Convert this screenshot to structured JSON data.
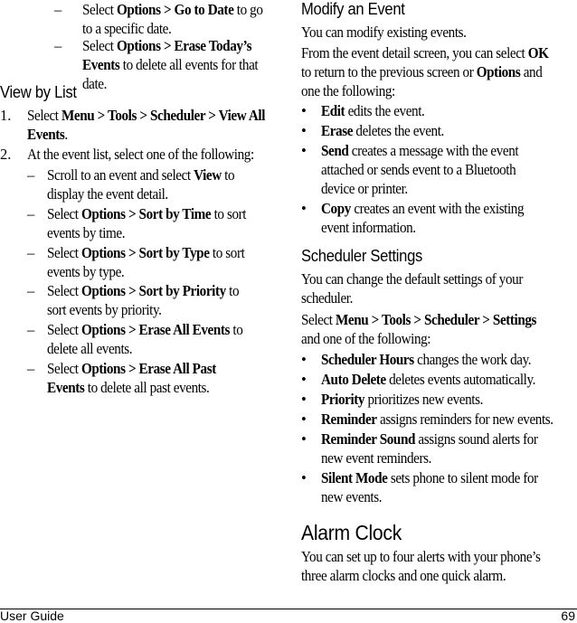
{
  "left_column": {
    "top_items": [
      {
        "marker": "–",
        "parts": [
          [
            "t",
            "Select "
          ],
          [
            "b",
            "Options > Go to Date"
          ],
          [
            "t",
            " to go to a specific date."
          ]
        ]
      },
      {
        "marker": "–",
        "parts": [
          [
            "t",
            "Select "
          ],
          [
            "b",
            "Options > Erase Today’s Events"
          ],
          [
            "t",
            " to delete all events for that date."
          ]
        ]
      }
    ],
    "view_by_list": {
      "heading": "View by List",
      "steps": [
        {
          "marker": "1.",
          "parts": [
            [
              "t",
              "Select "
            ],
            [
              "b",
              "Menu > Tools > Scheduler > View All Events"
            ],
            [
              "t",
              "."
            ]
          ]
        },
        {
          "marker": "2.",
          "parts": [
            [
              "t",
              "At the event list, select one of the following:"
            ]
          ]
        }
      ],
      "sub_items": [
        {
          "marker": "–",
          "parts": [
            [
              "t",
              "Scroll to an event and select "
            ],
            [
              "b",
              "View"
            ],
            [
              "t",
              " to display the event detail."
            ]
          ]
        },
        {
          "marker": "–",
          "parts": [
            [
              "t",
              "Select "
            ],
            [
              "b",
              "Options > Sort by Time"
            ],
            [
              "t",
              " to sort events by time."
            ]
          ]
        },
        {
          "marker": "–",
          "parts": [
            [
              "t",
              "Select "
            ],
            [
              "b",
              "Options > Sort by Type"
            ],
            [
              "t",
              " to sort events by type."
            ]
          ]
        },
        {
          "marker": "–",
          "parts": [
            [
              "t",
              "Select "
            ],
            [
              "b",
              "Options > Sort by Priority"
            ],
            [
              "t",
              " to sort events by priority."
            ]
          ]
        },
        {
          "marker": "–",
          "parts": [
            [
              "t",
              "Select "
            ],
            [
              "b",
              "Options > Erase All Events"
            ],
            [
              "t",
              " to delete all events."
            ]
          ]
        },
        {
          "marker": "–",
          "parts": [
            [
              "t",
              "Select "
            ],
            [
              "b",
              "Options > Erase All Past Events"
            ],
            [
              "t",
              " to delete all past events."
            ]
          ]
        }
      ]
    }
  },
  "right_column": {
    "modify_event": {
      "heading": "Modify an Event",
      "intro": "You can modify existing events.",
      "para_parts": [
        [
          "t",
          "From the event detail screen, you can select "
        ],
        [
          "b",
          "OK"
        ],
        [
          "t",
          " to return to the previous screen or "
        ],
        [
          "b",
          "Options"
        ],
        [
          "t",
          " and one the following:"
        ]
      ],
      "bullets": [
        {
          "marker": "•",
          "parts": [
            [
              "b",
              "Edit"
            ],
            [
              "t",
              " edits the event."
            ]
          ]
        },
        {
          "marker": "•",
          "parts": [
            [
              "b",
              "Erase"
            ],
            [
              "t",
              " deletes the event."
            ]
          ]
        },
        {
          "marker": "•",
          "parts": [
            [
              "b",
              "Send"
            ],
            [
              "t",
              " creates a message with the event attached or sends event to a Bluetooth device or printer."
            ]
          ]
        },
        {
          "marker": "•",
          "parts": [
            [
              "b",
              "Copy"
            ],
            [
              "t",
              " creates an event with the existing event information."
            ]
          ]
        }
      ]
    },
    "scheduler_settings": {
      "heading": "Scheduler Settings",
      "intro": "You can change the default settings of your scheduler.",
      "para_parts": [
        [
          "t",
          "Select "
        ],
        [
          "b",
          "Menu > Tools > Scheduler > Settings"
        ],
        [
          "t",
          " and one of the following:"
        ]
      ],
      "bullets": [
        {
          "marker": "•",
          "parts": [
            [
              "b",
              "Scheduler Hours"
            ],
            [
              "t",
              " changes the work day."
            ]
          ]
        },
        {
          "marker": "•",
          "parts": [
            [
              "b",
              "Auto Delete"
            ],
            [
              "t",
              " deletes events automatically."
            ]
          ]
        },
        {
          "marker": "•",
          "parts": [
            [
              "b",
              "Priority"
            ],
            [
              "t",
              " prioritizes new events."
            ]
          ]
        },
        {
          "marker": "•",
          "parts": [
            [
              "b",
              "Reminder"
            ],
            [
              "t",
              " assigns reminders for new events."
            ]
          ]
        },
        {
          "marker": "•",
          "parts": [
            [
              "b",
              "Reminder Sound"
            ],
            [
              "t",
              " assigns sound alerts for new event reminders."
            ]
          ]
        },
        {
          "marker": "•",
          "parts": [
            [
              "b",
              "Silent Mode"
            ],
            [
              "t",
              " sets phone to silent mode for new events."
            ]
          ]
        }
      ]
    },
    "alarm_clock": {
      "heading": "Alarm Clock",
      "body": "You can set up to four alerts with your phone’s three alarm clocks and one quick alarm."
    }
  },
  "footer": {
    "left": "User Guide",
    "page_number": "69"
  }
}
